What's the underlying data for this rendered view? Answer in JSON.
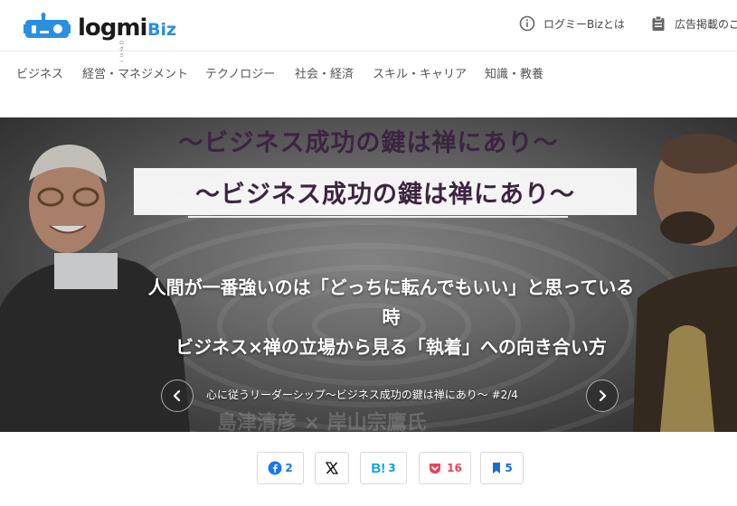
{
  "header": {
    "logo_word": "logmi",
    "logo_biz": "Biz",
    "logo_sub": "ログミー",
    "about_label": "ログミーBizとは",
    "ads_label": "広告掲載のご"
  },
  "nav": {
    "items": [
      {
        "label": "ビジネス"
      },
      {
        "label": "経営・マネジメント"
      },
      {
        "label": "テクノロジー"
      },
      {
        "label": "社会・経済"
      },
      {
        "label": "スキル・キャリア"
      },
      {
        "label": "知識・教養"
      }
    ]
  },
  "hero": {
    "banner_top": "〜ビジネス成功の鍵は禅にあり〜",
    "banner_box": "〜ビジネス成功の鍵は禅にあり〜",
    "title_line1": "人間が一番強いのは「どっちに転んでもいい」と思っている",
    "title_line2": "時",
    "title_line3": "ビジネス×禅の立場から見る「執着」への向き合い方",
    "series": "心に従うリーダーシップ〜ビジネス成功の鍵は禅にあり〜 #2/4",
    "ghost": "島津清彦 × 岸山宗鷹氏"
  },
  "share": {
    "facebook_count": "2",
    "hatena_count": "3",
    "pocket_count": "16",
    "bookmark_count": "5"
  },
  "colors": {
    "brand_blue": "#2a8fe0",
    "banner_purple": "#3c2440",
    "facebook": "#1877f2",
    "hatena": "#00a4de",
    "pocket": "#ef4056"
  },
  "icons": {
    "about": "info-circle-icon",
    "ads": "clipboard-icon",
    "prev": "chevron-left-icon",
    "next": "chevron-right-icon"
  }
}
